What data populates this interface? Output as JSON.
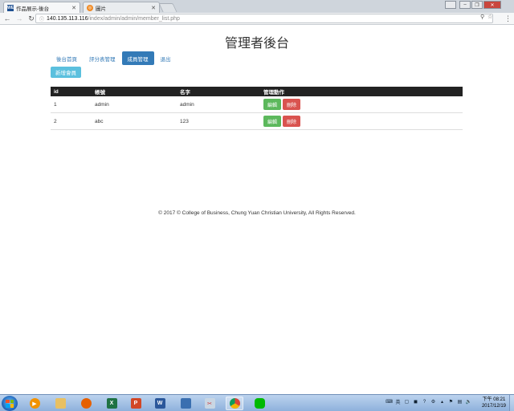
{
  "browser": {
    "tabs": [
      {
        "label": "作品展示-後台",
        "favicon": "WE",
        "favicon_color": "#1d4f91"
      },
      {
        "label": "圖片",
        "favicon": "◎",
        "favicon_color": "#f08a24"
      }
    ],
    "url_host": "140.135.113.116",
    "url_path": "/index/admin/admin/member_list.php"
  },
  "page": {
    "title": "管理者後台",
    "nav": [
      "後台首頁",
      "評分表管理",
      "成員管理",
      "退出"
    ],
    "active_nav_index": 2,
    "add_button": "新增會員",
    "table": {
      "headers": [
        "id",
        "帳號",
        "名字",
        "管理動作"
      ],
      "rows": [
        {
          "id": "1",
          "account": "admin",
          "name": "admin"
        },
        {
          "id": "2",
          "account": "abc",
          "name": "123"
        }
      ],
      "edit_label": "編輯",
      "delete_label": "刪除"
    },
    "footer": "© 2017 © College of Business, Chung Yuan Christian University, All Rights Reserved."
  },
  "taskbar": {
    "clock_time": "下午 08:21",
    "clock_date": "2017/12/19"
  },
  "colors": {
    "primary": "#337ab7",
    "info": "#5bc0de",
    "success": "#5cb85c",
    "danger": "#d9534f"
  }
}
